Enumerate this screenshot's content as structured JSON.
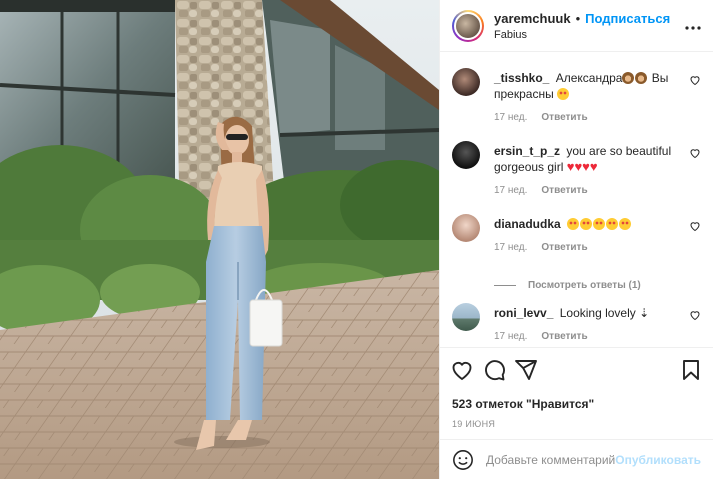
{
  "post": {
    "username": "yaremchuuk",
    "follow_label": "Подписаться",
    "separator": "•",
    "location": "Fabius",
    "more_icon": "more-horizontal-icon"
  },
  "comments": [
    {
      "user": "_tisshko_",
      "text": "Александра",
      "text_tail": " Вы прекрасны",
      "time": "17 нед.",
      "reply": "Ответить"
    },
    {
      "user": "ersin_t_p_z",
      "text": "you are so beautiful gorgeous girl",
      "time": "17 нед.",
      "reply": "Ответить"
    },
    {
      "user": "dianadudka",
      "text": "",
      "time": "17 нед.",
      "reply": "Ответить"
    },
    {
      "user": "roni_levv_",
      "text": "Looking lovely ⇣",
      "time": "17 нед.",
      "reply": "Ответить"
    }
  ],
  "view_replies": "Посмотреть ответы (1)",
  "actions": {
    "like_icon": "heart-icon",
    "comment_icon": "comment-icon",
    "share_icon": "share-icon",
    "save_icon": "bookmark-icon"
  },
  "likes_text": "523 отметок \"Нравится\"",
  "date_text": "19 ИЮНЯ",
  "add_comment": {
    "placeholder": "Добавьте комментарий...",
    "publish_label": "Опубликовать"
  },
  "colors": {
    "accent": "#0095f6",
    "publish_disabled": "#b2dffc",
    "muted": "#8e8e8e",
    "text": "#262626"
  }
}
